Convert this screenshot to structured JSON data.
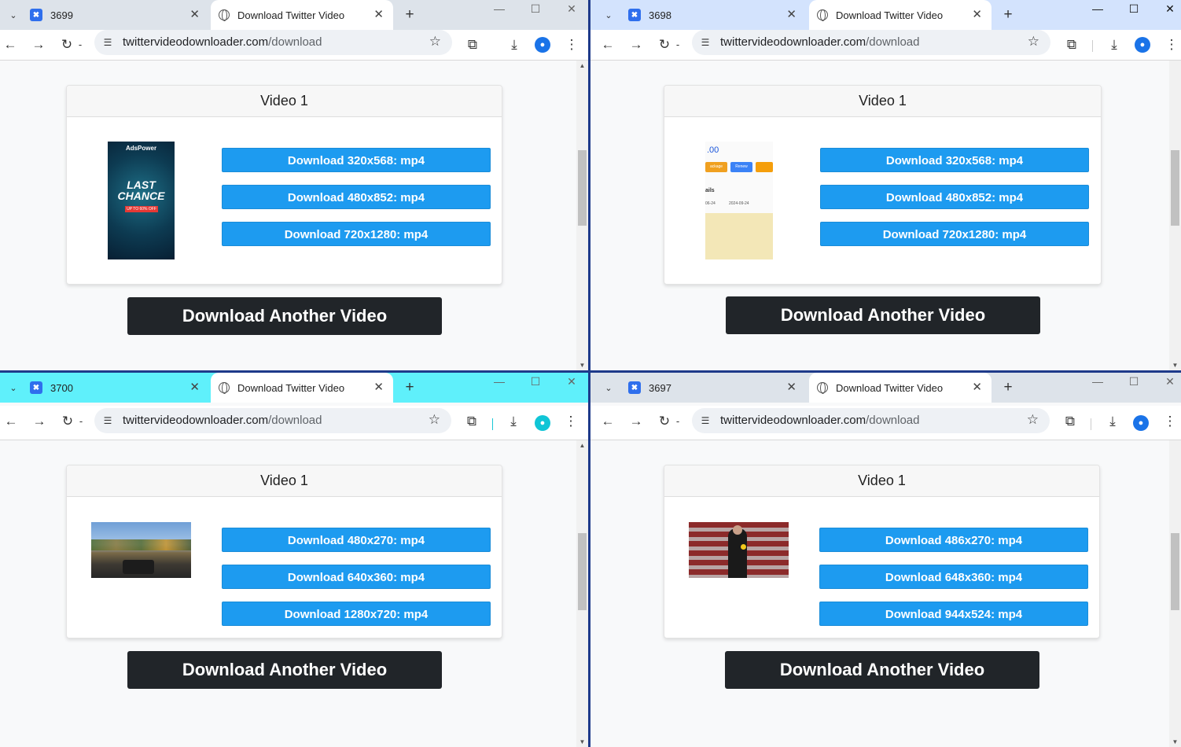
{
  "windows": [
    {
      "id": "w0",
      "inactive_tab_label": "3699",
      "active_tab_label": "Download Twitter Video",
      "url_host": "twittervideodownloader.com",
      "url_path": "/download",
      "card_title": "Video 1",
      "downloads": [
        "Download 320x568: mp4",
        "Download 480x852: mp4",
        "Download 720x1280: mp4"
      ],
      "another_label": "Download Another Video",
      "thumbnail": {
        "brand": "AdsPower",
        "headline1": "LAST",
        "headline2": "CHANCE",
        "tag": "UP TO 60% OFF"
      }
    },
    {
      "id": "w1",
      "inactive_tab_label": "3698",
      "active_tab_label": "Download Twitter Video",
      "url_host": "twittervideodownloader.com",
      "url_path": "/download",
      "card_title": "Video 1",
      "downloads": [
        "Download 320x568: mp4",
        "Download 480x852: mp4",
        "Download 720x1280: mp4"
      ],
      "another_label": "Download Another Video",
      "thumbnail": {
        "price": ".00",
        "btn1": "ackage",
        "btn2": "Renew",
        "heading": "ails",
        "date1": "06-24",
        "date2": "2024-09-24"
      }
    },
    {
      "id": "w2",
      "inactive_tab_label": "3700",
      "active_tab_label": "Download Twitter Video",
      "url_host": "twittervideodownloader.com",
      "url_path": "/download",
      "card_title": "Video 1",
      "downloads": [
        "Download 480x270: mp4",
        "Download 640x360: mp4",
        "Download 1280x720: mp4"
      ],
      "another_label": "Download Another Video"
    },
    {
      "id": "w3",
      "inactive_tab_label": "3697",
      "active_tab_label": "Download Twitter Video",
      "url_host": "twittervideodownloader.com",
      "url_path": "/download",
      "card_title": "Video 1",
      "downloads": [
        "Download 486x270: mp4",
        "Download 648x360: mp4",
        "Download 944x524: mp4"
      ],
      "another_label": "Download Another Video"
    }
  ],
  "icons": {
    "tab_search": "chevron-down-icon",
    "favicon_inactive": "x-app-icon",
    "favicon_active": "globe-icon",
    "back": "arrow-left-icon",
    "forward": "arrow-right-icon",
    "reload": "reload-icon",
    "site_info": "tune-icon",
    "bookmark": "star-icon",
    "extensions": "puzzle-icon",
    "downloads": "download-icon",
    "profile": "avatar-icon",
    "menu": "kebab-icon"
  },
  "colors": {
    "download_button": "#1d9bf0",
    "another_button": "#212529",
    "page_bg": "#f8f9fa"
  }
}
